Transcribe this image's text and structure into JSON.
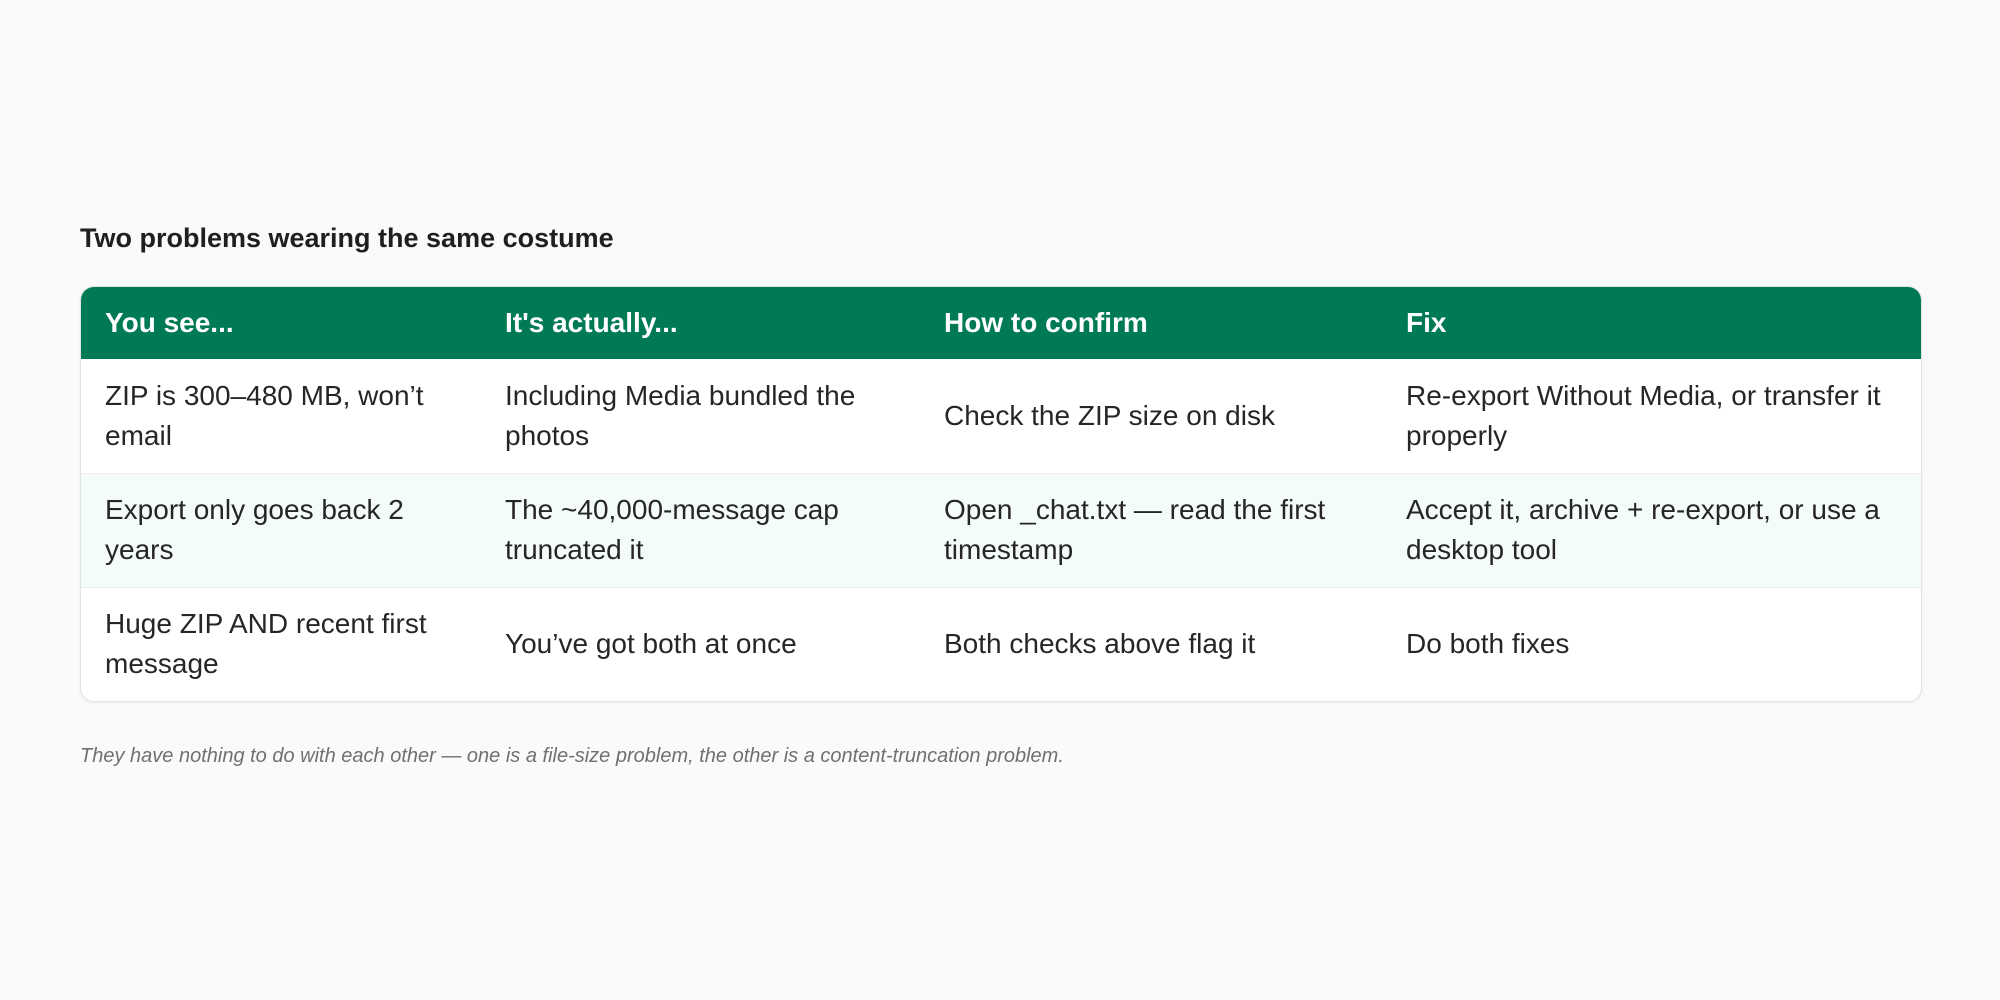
{
  "title": "Two problems wearing the same costume",
  "table": {
    "headers": [
      "You see...",
      "It's actually...",
      "How to confirm",
      "Fix"
    ],
    "rows": [
      [
        "ZIP is 300–480 MB, won’t email",
        "Including Media bundled the photos",
        "Check the ZIP size on disk",
        "Re-export Without Media, or transfer it properly"
      ],
      [
        "Export only goes back 2 years",
        "The ~40,000-message cap truncated it",
        "Open _chat.txt — read the first timestamp",
        "Accept it, archive + re-export, or use a desktop tool"
      ],
      [
        "Huge ZIP AND recent first message",
        "You’ve got both at once",
        "Both checks above flag it",
        "Do both fixes"
      ]
    ]
  },
  "footnote": "They have nothing to do with each other — one is a file-size problem, the other is a content-truncation problem.",
  "colors": {
    "header_bg": "#007a55",
    "alt_row_bg": "#f3fcf8",
    "page_bg": "#fafafa"
  }
}
